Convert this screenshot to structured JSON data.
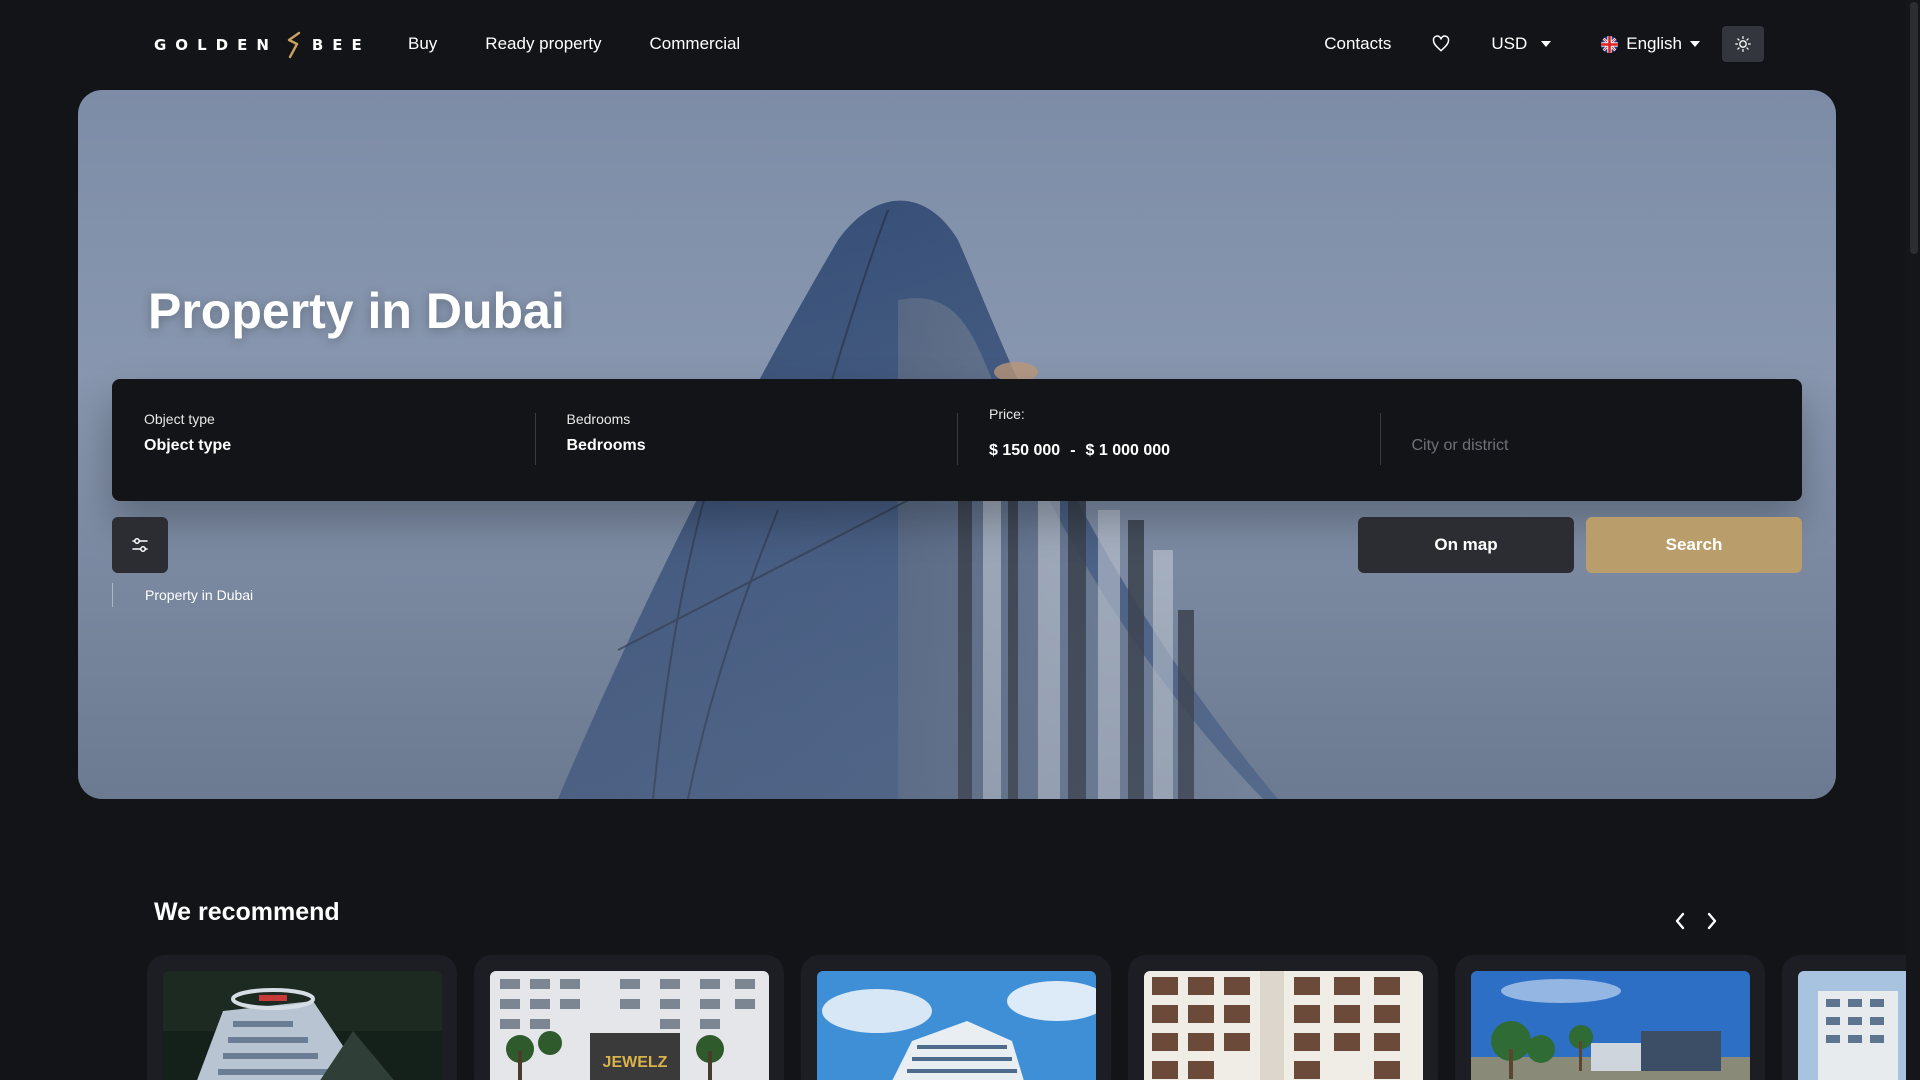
{
  "header": {
    "logo_left": "GOLDEN",
    "logo_right": "BEE",
    "nav": [
      "Buy",
      "Ready property",
      "Commercial"
    ],
    "contacts": "Contacts",
    "currency": "USD",
    "language": "English"
  },
  "hero": {
    "title": "Property in Dubai",
    "breadcrumb": "Property in Dubai",
    "search": {
      "object_type_label": "Object type",
      "object_type_value": "Object type",
      "bedrooms_label": "Bedrooms",
      "bedrooms_value": "Bedrooms",
      "price_label": "Price:",
      "price_from": "$ 150 000",
      "price_sep": "-",
      "price_to": "$ 1 000 000",
      "city_placeholder": "City or district"
    },
    "on_map": "On map",
    "search_button": "Search"
  },
  "recommend": {
    "title": "We recommend",
    "cards": [
      {
        "sign": ""
      },
      {
        "sign": "JEWELZ"
      },
      {
        "sign": ""
      },
      {
        "sign": ""
      },
      {
        "sign": ""
      },
      {
        "sign": ""
      }
    ]
  },
  "colors": {
    "page_bg": "#131418",
    "search_button": "#b99d6a",
    "secondary_button": "#2b2d32"
  },
  "icons": [
    "bee-logo-icon",
    "heart-icon",
    "uk-flag-icon",
    "sun-icon",
    "filter-sliders-icon",
    "chevron-left-icon",
    "chevron-right-icon"
  ]
}
